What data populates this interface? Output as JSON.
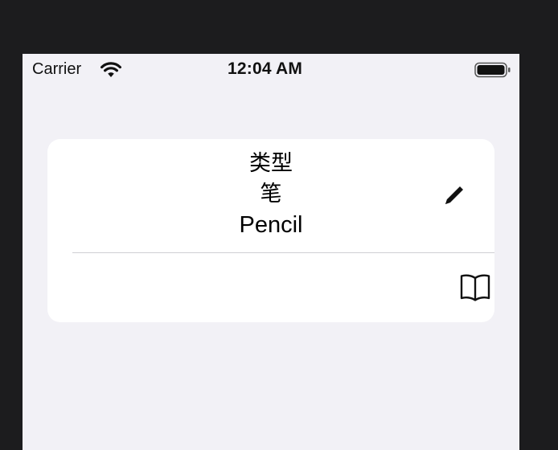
{
  "status_bar": {
    "carrier": "Carrier",
    "time": "12:04 AM",
    "wifi_icon": "wifi-icon",
    "battery_icon": "battery-full-icon"
  },
  "list": {
    "items": [
      {
        "lines": [
          "类型",
          "笔",
          "Pencil"
        ],
        "icon": "pencil-icon"
      },
      {
        "lines": [],
        "icon": "book-icon"
      }
    ]
  },
  "colors": {
    "background": "#f2f1f6",
    "card": "#ffffff",
    "separator": "#cfcfd4"
  }
}
